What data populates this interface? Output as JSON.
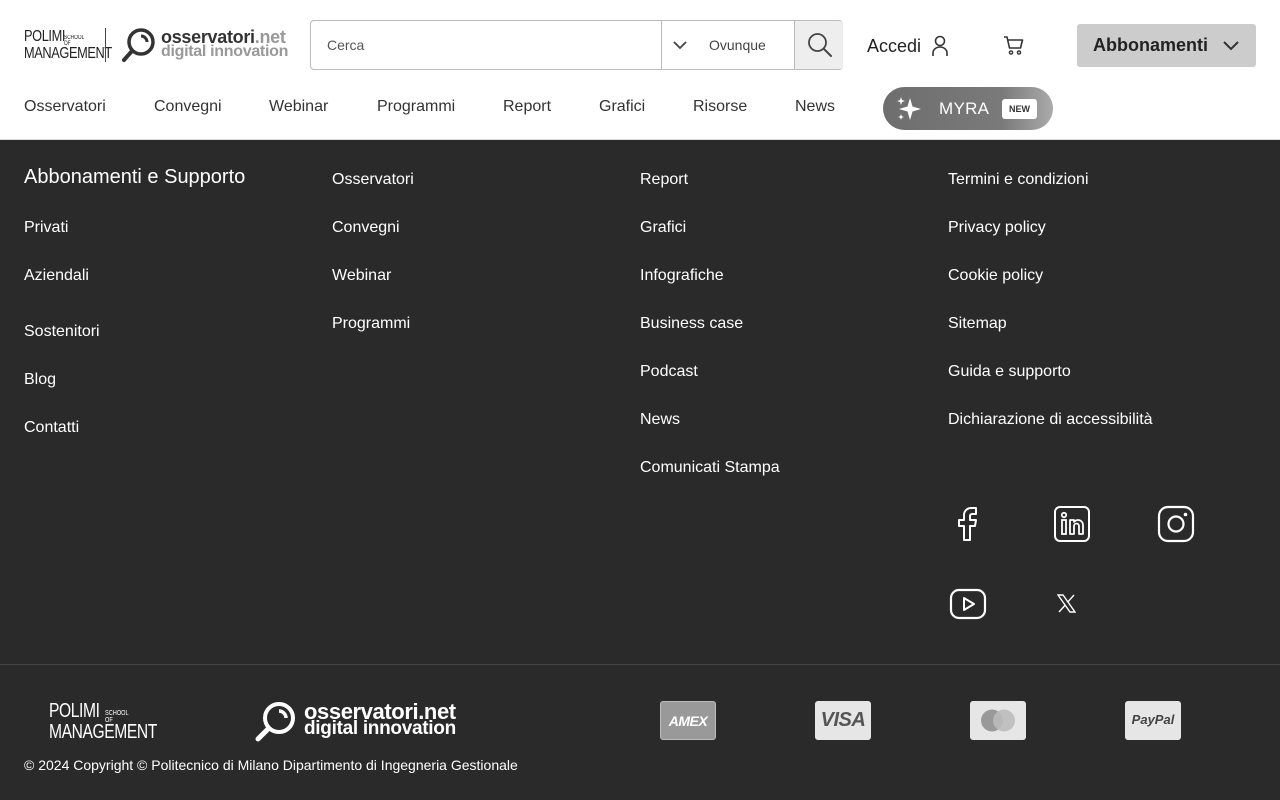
{
  "header": {
    "logo_polimi": {
      "line1": "POLIMI",
      "line2": "MANAGEMENT",
      "small": "SCHOOL OF"
    },
    "logo_osservatori": {
      "name": "osservatori",
      "tld": ".net",
      "tagline": "digital innovation"
    },
    "search": {
      "placeholder": "Cerca",
      "value": "",
      "scope": "Ovunque"
    },
    "login_label": "Accedi",
    "subscriptions_label": "Abbonamenti"
  },
  "nav": {
    "items": [
      "Osservatori",
      "Convegni",
      "Webinar",
      "Programmi",
      "Report",
      "Grafici",
      "Risorse",
      "News"
    ],
    "myra": {
      "label": "MYRA",
      "badge": "NEW"
    }
  },
  "footer": {
    "col1": {
      "title": "Abbonamenti e Supporto",
      "items": [
        "Privati",
        "Aziendali",
        "Sostenitori",
        "Blog",
        "Contatti"
      ]
    },
    "col2": {
      "items": [
        "Osservatori",
        "Convegni",
        "Webinar",
        "Programmi"
      ]
    },
    "col3": {
      "items": [
        "Report",
        "Grafici",
        "Infografiche",
        "Business case",
        "Podcast",
        "News",
        "Comunicati Stampa"
      ]
    },
    "col4": {
      "items": [
        "Termini e condizioni",
        "Privacy policy",
        "Cookie policy",
        "Sitemap",
        "Guida e supporto",
        "Dichiarazione di accessibilità"
      ]
    },
    "social_icons": [
      "facebook-icon",
      "linkedin-icon",
      "instagram-icon",
      "youtube-icon",
      "x-icon"
    ],
    "logo_polimi": {
      "line1": "POLIMI",
      "line2": "MANAGEMENT",
      "small": "SCHOOL OF"
    },
    "logo_osservatori": {
      "name": "osservatori.net",
      "tagline": "digital innovation"
    },
    "payments": {
      "amex": "AMEX",
      "visa": "VISA",
      "mastercard": "mastercard",
      "paypal": "PayPal"
    },
    "copyright": "© 2024 Copyright © Politecnico di Milano Dipartimento di Ingegneria Gestionale"
  },
  "colors": {
    "footer_bg": "#2a2a2a",
    "header_bg": "#ffffff",
    "button_bg": "#cccccc"
  }
}
